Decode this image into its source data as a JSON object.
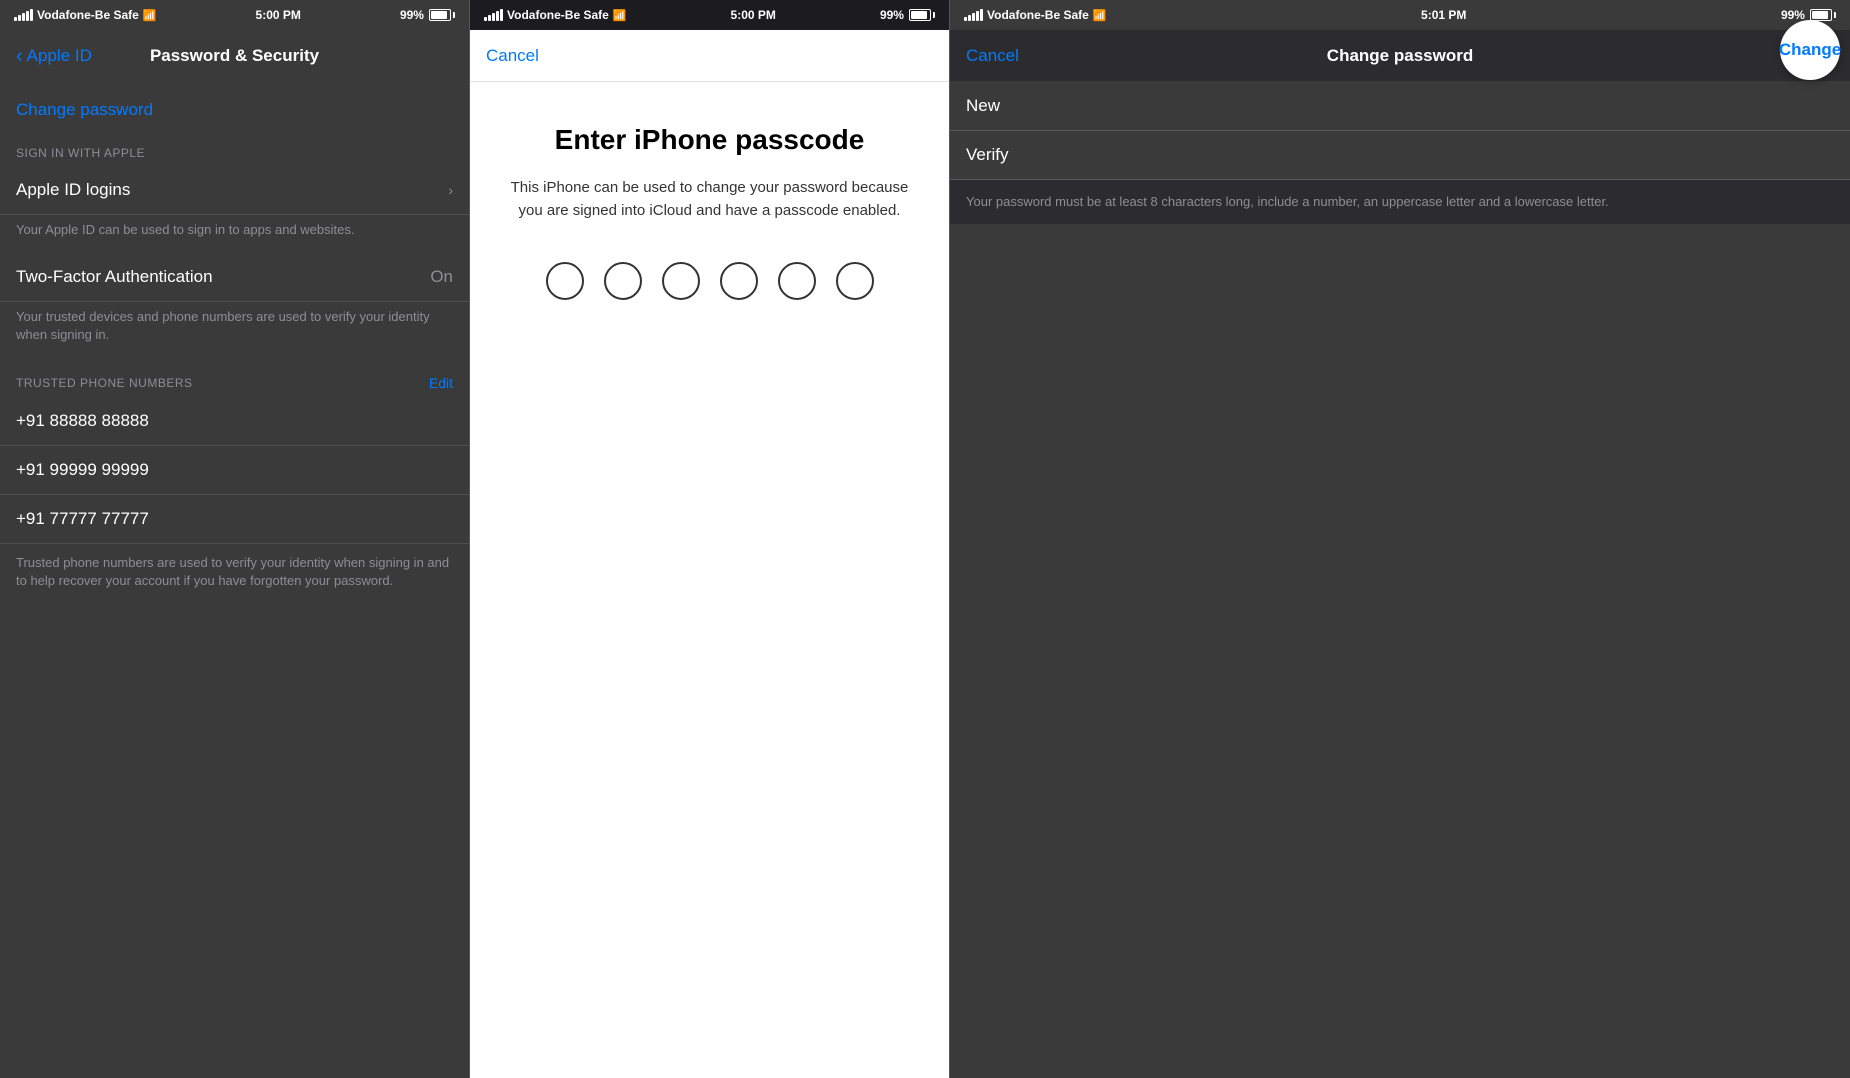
{
  "panel1": {
    "statusBar": {
      "carrier": "Vodafone-Be Safe",
      "wifi": "WiFi",
      "time": "5:00 PM",
      "battery": "99%"
    },
    "navBackLabel": "Apple ID",
    "navTitle": "Password & Security",
    "changePasswordLabel": "Change password",
    "signInSection": {
      "sectionLabel": "SIGN IN WITH APPLE",
      "appleIdLoginsLabel": "Apple ID logins",
      "appleIdLoginsSubtitle": "Your Apple ID can be used to sign in to apps and websites."
    },
    "twoFactorLabel": "Two-Factor Authentication",
    "twoFactorValue": "On",
    "twoFactorSubtitle": "Your trusted devices and phone numbers are used to verify your identity when signing in.",
    "trustedPhones": {
      "sectionLabel": "TRUSTED PHONE NUMBERS",
      "editLabel": "Edit",
      "numbers": [
        "+91 88888 88888",
        "+91 99999 99999",
        "+91 77777 77777"
      ],
      "footer": "Trusted phone numbers are used to verify your identity when signing in and to help recover your account if you have forgotten your password."
    }
  },
  "panel2": {
    "statusBar": {
      "carrier": "Vodafone-Be Safe",
      "wifi": "WiFi",
      "time": "5:00 PM",
      "battery": "99%"
    },
    "cancelLabel": "Cancel",
    "title": "Enter iPhone passcode",
    "description": "This iPhone can be used to change your password because you are signed into iCloud and have a passcode enabled.",
    "dotsCount": 6
  },
  "panel3": {
    "statusBar": {
      "carrier": "Vodafone-Be Safe",
      "wifi": "WiFi",
      "time": "5:01 PM",
      "battery": "99%"
    },
    "cancelLabel": "Cancel",
    "navTitle": "Change password",
    "changeLabel": "Change",
    "newFieldLabel": "New",
    "verifyFieldLabel": "Verify",
    "footerText": "Your password must be at least 8 characters long, include a number, an uppercase letter and a lowercase letter."
  }
}
